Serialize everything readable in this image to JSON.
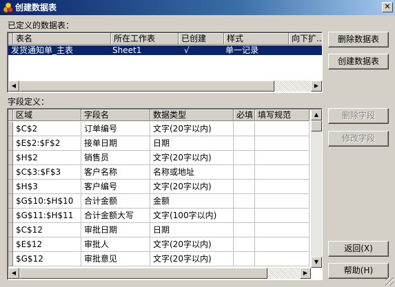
{
  "window": {
    "title": "创建数据表",
    "close_glyph": "✕"
  },
  "defined_tables": {
    "label": "已定义的数据表：",
    "columns": [
      "表名",
      "所在工作表",
      "已创建",
      "样式",
      "向下扩..."
    ],
    "rows": [
      [
        "发货通知单_主表",
        "Sheet1",
        "√",
        "单一记录",
        ""
      ]
    ]
  },
  "fields": {
    "label": "字段定义：",
    "columns": [
      "区域",
      "字段名",
      "数据类型",
      "必填",
      "填写规范"
    ],
    "rows": [
      [
        "$C$2",
        "订单编号",
        "文字(20字以内)",
        "",
        ""
      ],
      [
        "$E$2:$F$2",
        "接单日期",
        "日期",
        "",
        ""
      ],
      [
        "$H$2",
        "销售员",
        "文字(20字以内)",
        "",
        ""
      ],
      [
        "$C$3:$F$3",
        "客户名称",
        "名称或地址",
        "",
        ""
      ],
      [
        "$H$3",
        "客户编号",
        "文字(20字以内)",
        "",
        ""
      ],
      [
        "$G$10:$H$10",
        "合计金额",
        "金额",
        "",
        ""
      ],
      [
        "$G$11:$H$11",
        "合计金额大写",
        "文字(100字以内)",
        "",
        ""
      ],
      [
        "$C$12",
        "审批日期",
        "日期",
        "",
        ""
      ],
      [
        "$E$12",
        "审批人",
        "文字(20字以内)",
        "",
        ""
      ],
      [
        "$G$12",
        "审批意见",
        "文字(20字以内)",
        "",
        ""
      ]
    ]
  },
  "buttons": {
    "delete_table": "删除数据表",
    "create_table": "创建数据表",
    "delete_field": "删除字段",
    "modify_field": "修改字段",
    "back": "返回(X)",
    "help": "帮助(H)"
  },
  "icons": {
    "app": "app-icon",
    "close": "close-icon"
  }
}
